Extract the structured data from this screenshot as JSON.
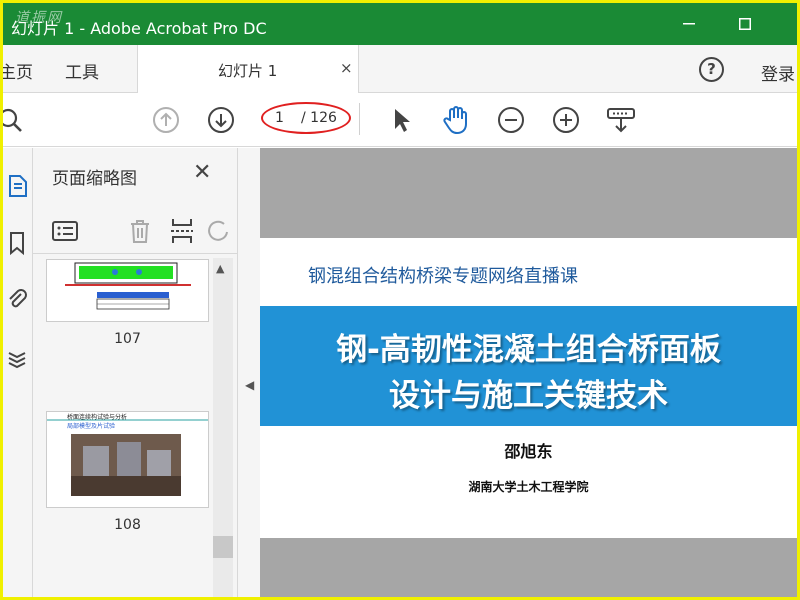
{
  "window": {
    "watermark": "道振网",
    "title": "幻灯片 1 - Adobe Acrobat Pro DC"
  },
  "menu": {
    "home": "主页",
    "tools": "工具",
    "tab_label": "幻灯片 1",
    "tab_close": "×",
    "help": "?",
    "signin": "登录"
  },
  "toolbar": {
    "current_page": "1",
    "total_pages": "/ 126"
  },
  "thumbnail_panel": {
    "title": "页面缩略图",
    "close": "✕",
    "thumbnails": [
      {
        "page": "107"
      },
      {
        "page": "108",
        "caption": "桥面连续构试验与分析",
        "sub": "局部模型及片试验"
      }
    ]
  },
  "slide": {
    "subtitle": "钢混组合结构桥梁专题网络直播课",
    "title_line1": "钢-高韧性混凝土组合桥面板",
    "title_line2": "设计与施工关键技术",
    "author": "邵旭东",
    "affiliation": "湖南大学土木工程学院"
  },
  "colors": {
    "titlebar": "#1a8a35",
    "banner": "#2192d6",
    "subtitle": "#1f5a9c",
    "highlight_oval": "#e02020",
    "outer_border": "#f0f000"
  },
  "icons": [
    "search-icon",
    "up-arrow-circle-icon",
    "down-arrow-circle-icon",
    "cursor-icon",
    "hand-icon",
    "zoom-out-icon",
    "zoom-in-icon",
    "keyboard-scroll-icon",
    "attach-icon",
    "bookmark-icon",
    "signature-icon",
    "layers-icon",
    "options-icon",
    "delete-icon",
    "insert-page-icon",
    "rotate-icon"
  ]
}
